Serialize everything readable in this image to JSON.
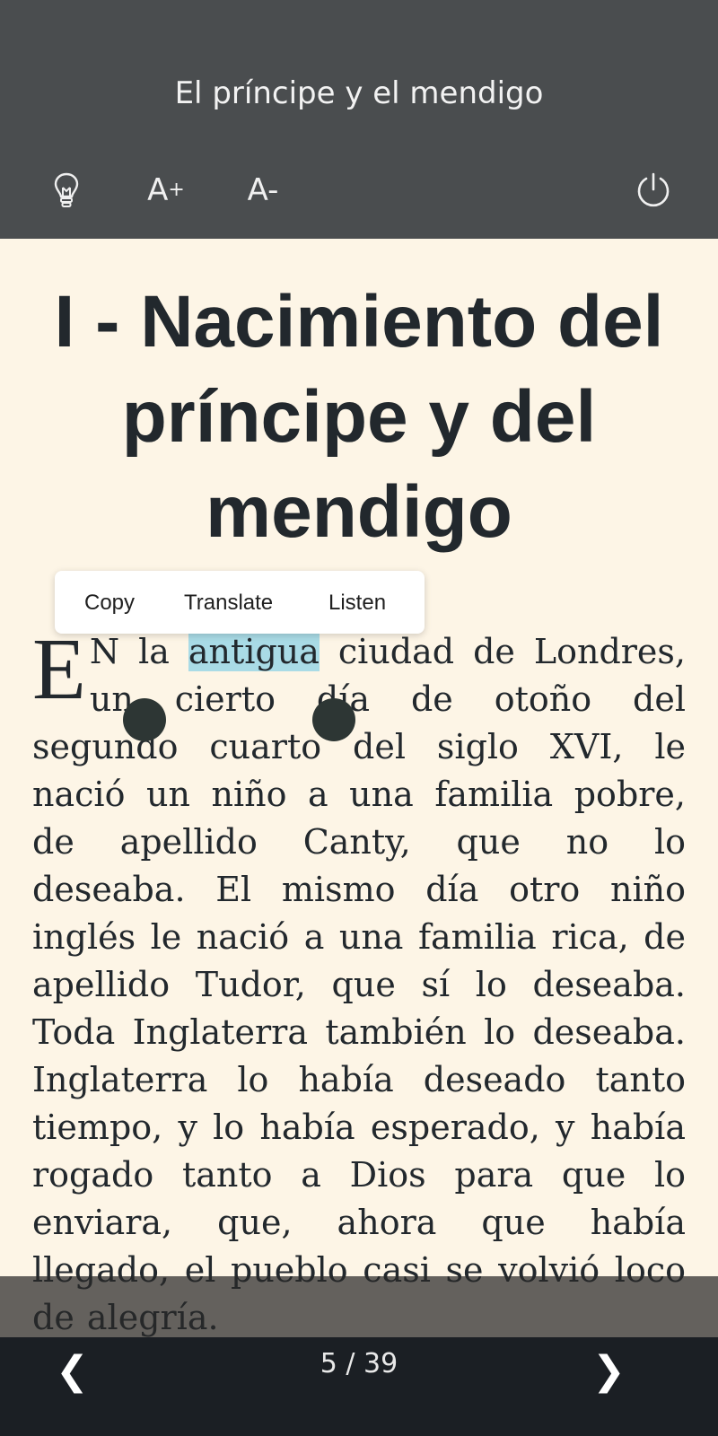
{
  "header": {
    "book_title": "El príncipe y el mendigo",
    "toolbar": {
      "bulb_icon": "lightbulb-icon",
      "font_increase_label": "A",
      "font_increase_sign": "+",
      "font_decrease_label": "A-",
      "power_icon": "power-icon"
    }
  },
  "content": {
    "chapter_title": "I - Nacimiento del príncipe y del mendigo",
    "drop_cap": "E",
    "para_before_sel": "N la ",
    "selected_word": "antigua",
    "para_after_sel": " ciudad de Londres, un cierto día de otoño del segundo cuarto del siglo XVI, le nació un niño a una familia pobre, de apellido Canty, que no lo deseaba. El mismo día otro niño inglés le nació a una familia rica, de apellido Tudor, que sí lo deseaba. Toda Inglaterra también lo deseaba. Inglaterra lo había deseado tanto tiempo, y lo había esperado, y había rogado tanto a Dios para que lo enviara, que, ahora que había llegado, el pueblo casi se volvió loco de alegría."
  },
  "selection_menu": {
    "copy": "Copy",
    "translate": "Translate",
    "listen": "Listen"
  },
  "footer": {
    "prev": "❮",
    "next": "❯",
    "page_indicator": "5 / 39"
  },
  "colors": {
    "topbar": "#4a4d4f",
    "page_bg": "#fdf5e6",
    "selection": "#a9dbe6",
    "bottombar": "#1b1f24"
  }
}
